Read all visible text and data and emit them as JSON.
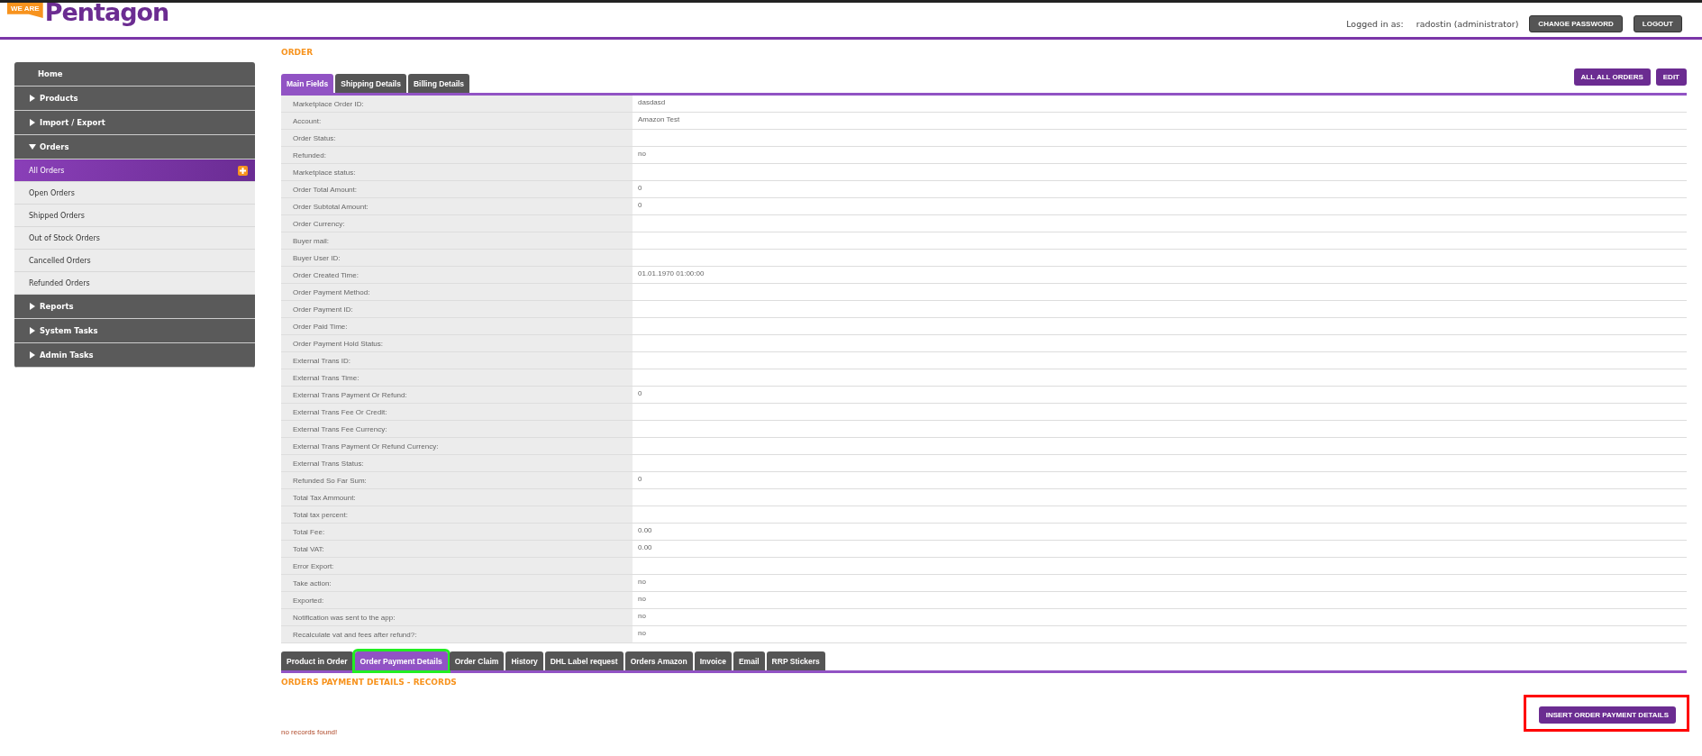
{
  "header": {
    "logo_tag": "WE ARE",
    "logo_text": "Pentagon",
    "logged_in_label": "Logged in as:",
    "user": "radostin (administrator)",
    "buttons": [
      "CHANGE PASSWORD",
      "LOGOUT"
    ]
  },
  "sidebar": {
    "items": [
      {
        "kind": "header",
        "label": "Home"
      },
      {
        "kind": "section",
        "label": "Products",
        "expanded": false
      },
      {
        "kind": "section",
        "label": "Import / Export",
        "expanded": false
      },
      {
        "kind": "section",
        "label": "Orders",
        "expanded": true
      },
      {
        "kind": "page",
        "label": "All Orders",
        "selected": true,
        "add": true
      },
      {
        "kind": "page",
        "label": "Open Orders",
        "selected": false,
        "add": false
      },
      {
        "kind": "page",
        "label": "Shipped Orders",
        "selected": false,
        "add": false
      },
      {
        "kind": "page",
        "label": "Out of Stock Orders",
        "selected": false,
        "add": false
      },
      {
        "kind": "page",
        "label": "Cancelled Orders",
        "selected": false,
        "add": false
      },
      {
        "kind": "page",
        "label": "Refunded Orders",
        "selected": false,
        "add": false
      },
      {
        "kind": "section",
        "label": "Reports",
        "expanded": false
      },
      {
        "kind": "section",
        "label": "System Tasks",
        "expanded": false
      },
      {
        "kind": "section",
        "label": "Admin Tasks",
        "expanded": false
      }
    ]
  },
  "order": {
    "title": "ORDER",
    "tabs": [
      {
        "label": "Main Fields",
        "selected": true
      },
      {
        "label": "Shipping Details",
        "selected": false
      },
      {
        "label": "Billing Details",
        "selected": false
      }
    ],
    "actions": [
      "ALL ALL ORDERS",
      "EDIT"
    ],
    "fields": [
      {
        "label": "Marketplace Order ID:",
        "value": "dasdasd"
      },
      {
        "label": "Account:",
        "value": "Amazon Test"
      },
      {
        "label": "Order Status:"
      },
      {
        "label": "Refunded:",
        "value": "no"
      },
      {
        "label": "Marketplace status:"
      },
      {
        "label": "Order Total Amount:",
        "value": "0"
      },
      {
        "label": "Order Subtotal Amount:",
        "value": "0"
      },
      {
        "label": "Order Currency:"
      },
      {
        "label": "Buyer mail:"
      },
      {
        "label": "Buyer User ID:"
      },
      {
        "label": "Order Created Time:",
        "value": "01.01.1970 01:00:00"
      },
      {
        "label": "Order Payment Method:"
      },
      {
        "label": "Order Payment ID:"
      },
      {
        "label": "Order Paid Time:"
      },
      {
        "label": "Order Payment Hold Status:"
      },
      {
        "label": "External Trans ID:"
      },
      {
        "label": "External Trans Time:"
      },
      {
        "label": "External Trans Payment Or Refund:",
        "value": "0"
      },
      {
        "label": "External Trans Fee Or Credit:"
      },
      {
        "label": "External Trans Fee Currency:"
      },
      {
        "label": "External Trans Payment Or Refund Currency:"
      },
      {
        "label": "External Trans Status:"
      },
      {
        "label": "Refunded So Far Sum:",
        "value": "0"
      },
      {
        "label": "Total Tax Ammount:"
      },
      {
        "label": "Total tax percent:"
      },
      {
        "label": "Total Fee:",
        "value": "0.00"
      },
      {
        "label": "Total VAT:",
        "value": "0.00"
      },
      {
        "label": "Error Export:"
      },
      {
        "label": "Take action:",
        "value": "no"
      },
      {
        "label": "Exported:",
        "value": "no"
      },
      {
        "label": "Notification was sent to the app:",
        "value": "no"
      },
      {
        "label": "Recalculate vat and fees after refund?:",
        "value": "no"
      }
    ]
  },
  "details": {
    "tabs": [
      {
        "label": "Product in Order",
        "selected": false,
        "highlighted": false
      },
      {
        "label": "Order Payment Details",
        "selected": true,
        "highlighted": true
      },
      {
        "label": "Order Claim",
        "selected": false,
        "highlighted": false
      },
      {
        "label": "History",
        "selected": false,
        "highlighted": false
      },
      {
        "label": "DHL Label request",
        "selected": false,
        "highlighted": false
      },
      {
        "label": "Orders Amazon",
        "selected": false,
        "highlighted": false
      },
      {
        "label": "Invoice",
        "selected": false,
        "highlighted": false
      },
      {
        "label": "Email",
        "selected": false,
        "highlighted": false
      },
      {
        "label": "RRP Stickers",
        "selected": false,
        "highlighted": false
      }
    ],
    "title": "ORDERS PAYMENT DETAILS - RECORDS",
    "insert_button": {
      "label": "INSERT ORDER PAYMENT DETAILS",
      "highlighted": true
    },
    "empty_message": "no records found!"
  }
}
